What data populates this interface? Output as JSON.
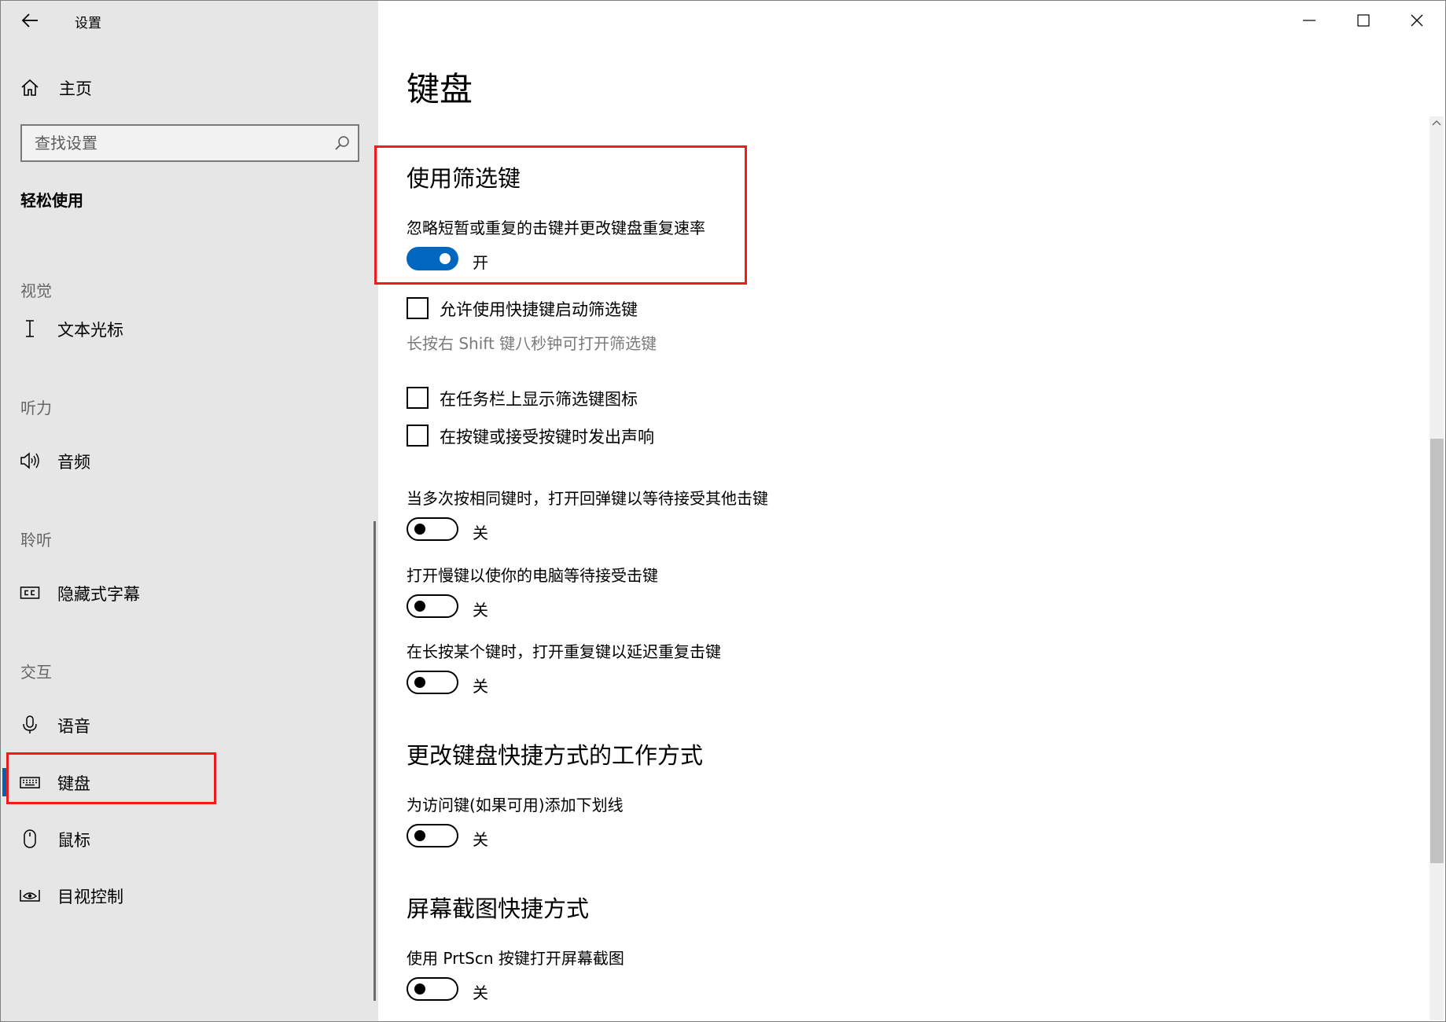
{
  "window": {
    "title": "设置",
    "controls": {
      "minimize": "minimize-icon",
      "maximize": "maximize-icon",
      "close": "close-icon"
    }
  },
  "sidebar": {
    "home_label": "主页",
    "search_placeholder": "查找设置",
    "section_heading": "轻松使用",
    "groups": [
      {
        "label": "视觉",
        "items": [
          {
            "label": "文本光标",
            "icon": "text-cursor-icon"
          }
        ]
      },
      {
        "label": "听力",
        "items": [
          {
            "label": "音频",
            "icon": "speaker-icon"
          }
        ]
      },
      {
        "label": "聆听",
        "items": [
          {
            "label": "隐藏式字幕",
            "icon": "closed-captions-icon"
          }
        ]
      },
      {
        "label": "交互",
        "items": [
          {
            "label": "语音",
            "icon": "microphone-icon"
          },
          {
            "label": "键盘",
            "icon": "keyboard-icon",
            "selected": true
          },
          {
            "label": "鼠标",
            "icon": "mouse-icon"
          },
          {
            "label": "目视控制",
            "icon": "eye-control-icon"
          }
        ]
      }
    ]
  },
  "main": {
    "title": "键盘",
    "filter_keys": {
      "heading": "使用筛选键",
      "description": "忽略短暂或重复的击键并更改键盘重复速率",
      "toggle_state": "开",
      "toggle_on": true,
      "shortcut_checkbox": "允许使用快捷键启动筛选键",
      "shortcut_hint": "长按右 Shift 键八秒钟可打开筛选键",
      "taskbar_checkbox": "在任务栏上显示筛选键图标",
      "beep_checkbox": "在按键或接受按键时发出声响"
    },
    "bounce_keys": {
      "description": "当多次按相同键时，打开回弹键以等待接受其他击键",
      "toggle_state": "关"
    },
    "slow_keys": {
      "description": "打开慢键以使你的电脑等待接受击键",
      "toggle_state": "关"
    },
    "repeat_keys": {
      "description": "在长按某个键时，打开重复键以延迟重复击键",
      "toggle_state": "关"
    },
    "shortcuts_section": {
      "heading": "更改键盘快捷方式的工作方式",
      "description": "为访问键(如果可用)添加下划线",
      "toggle_state": "关"
    },
    "screenshot_section": {
      "heading": "屏幕截图快捷方式",
      "description": "使用 PrtScn 按键打开屏幕截图",
      "toggle_state": "关"
    }
  },
  "colors": {
    "accent": "#0067c0",
    "highlight_box": "#ee1c1c",
    "sidebar_bg": "#e6e6e6"
  }
}
